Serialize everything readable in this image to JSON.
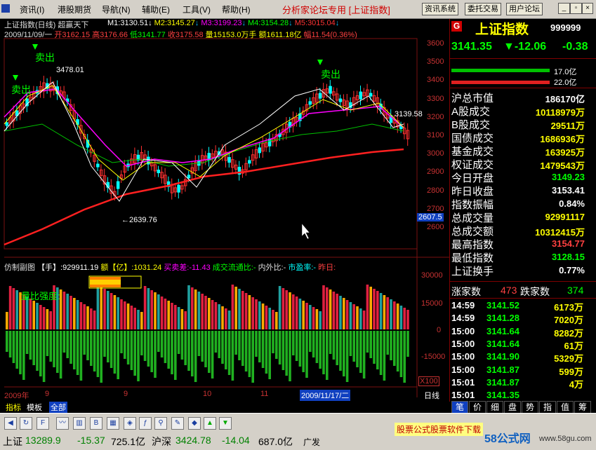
{
  "menu": {
    "items": [
      "资讯(I)",
      "港股期货",
      "导航(N)",
      "辅助(E)",
      "工具(V)",
      "帮助(H)"
    ],
    "title": "分析家论坛专用 [上证指数]",
    "buttons": [
      "资讯系统",
      "委托交易",
      "用户论坛"
    ]
  },
  "chart": {
    "name_line": "上证指数(日线) 超赢天下",
    "ma": [
      {
        "label": "M1:3130.51",
        "color": "#ffffff"
      },
      {
        "label": "M2:3145.27",
        "color": "#ffff00"
      },
      {
        "label": "M3:3199.23",
        "color": "#ff00ff"
      },
      {
        "label": "M4:3154.28",
        "color": "#00ff00"
      },
      {
        "label": "M5:3015.04",
        "color": "#ff3333"
      }
    ],
    "ohlc_line": {
      "date": "2009/11/09/一",
      "open": "开3162.15",
      "high": "高3176.66",
      "low": "低3141.77",
      "close": "收3175.58",
      "volume": "量15153.0万手",
      "amount": "额1611.18亿",
      "range": "幅11.54(0.36%)"
    },
    "annotations": {
      "sell1": "卖出",
      "sell2": "卖出",
      "sell3": "卖出",
      "high": "3478.01",
      "low": "←2639.76",
      "last": "3139.58",
      "cursor_price": "2607.5"
    },
    "price_ticks": [
      "3600",
      "3500",
      "3400",
      "3300",
      "3200",
      "3100",
      "3000",
      "2900",
      "2800",
      "2700",
      "2600"
    ],
    "sub_line": {
      "name": "仿制副图",
      "hand": "【手】:929911.19",
      "amount": "额【亿】:1031.24",
      "buy_sell": "买卖差:-11.43",
      "flow": "成交流通比:-",
      "inout": "内外比:-",
      "pe": "市盈率:-",
      "yesterday": "昨日:"
    },
    "sub_label": "量比强度:",
    "sub_ticks": [
      "30000",
      "15000",
      "0",
      "-15000"
    ],
    "x100": "X100",
    "date_labels": [
      {
        "text": "2009年",
        "color": "#c83232"
      },
      {
        "text": "9",
        "color": "#c83232"
      },
      {
        "text": "9",
        "color": "#c83232"
      },
      {
        "text": "10",
        "color": "#c83232"
      },
      {
        "text": "11",
        "color": "#c83232"
      }
    ],
    "cursor_date": "2009/11/17/二",
    "period": "日线"
  },
  "panel": {
    "badge": "G",
    "name": "上证指数",
    "code": "999999",
    "price": "3141.35",
    "change": "▼-12.06",
    "change_pct": "-0.38",
    "bar1": "17.0亿",
    "bar2": "22.0亿",
    "stats": [
      {
        "label": "沪总市值",
        "value": "186170亿",
        "color": "#ffffff"
      },
      {
        "label": "A股成交",
        "value": "10118979万",
        "color": "#ffff00"
      },
      {
        "label": "B股成交",
        "value": "29511万",
        "color": "#ffff00"
      },
      {
        "label": "国债成交",
        "value": "1686936万",
        "color": "#ffff00"
      },
      {
        "label": "基金成交",
        "value": "163925万",
        "color": "#ffff00"
      },
      {
        "label": "权证成交",
        "value": "1479543万",
        "color": "#ffff00"
      },
      {
        "label": "今日开盘",
        "value": "3149.23",
        "color": "#00ff00"
      },
      {
        "label": "昨日收盘",
        "value": "3153.41",
        "color": "#ffffff"
      },
      {
        "label": "指数振幅",
        "value": "0.84%",
        "color": "#ffffff"
      },
      {
        "label": "总成交量",
        "value": "92991117",
        "color": "#ffff00"
      },
      {
        "label": "总成交额",
        "value": "10312415万",
        "color": "#ffff00"
      },
      {
        "label": "最高指数",
        "value": "3154.77",
        "color": "#ff4040"
      },
      {
        "label": "最低指数",
        "value": "3128.15",
        "color": "#00ff00"
      },
      {
        "label": "上证换手",
        "value": "0.77%",
        "color": "#ffffff"
      }
    ],
    "rise_label": "涨家数",
    "rise": "473",
    "fall_label": "跌家数",
    "fall": "374",
    "ticks": [
      {
        "time": "14:59",
        "price": "3141.52",
        "vol": "6173万"
      },
      {
        "time": "14:59",
        "price": "3141.28",
        "vol": "7020万"
      },
      {
        "time": "15:00",
        "price": "3141.64",
        "vol": "8282万"
      },
      {
        "time": "15:00",
        "price": "3141.64",
        "vol": "61万"
      },
      {
        "time": "15:00",
        "price": "3141.90",
        "vol": "5329万"
      },
      {
        "time": "15:00",
        "price": "3141.87",
        "vol": "599万"
      },
      {
        "time": "15:01",
        "price": "3141.87",
        "vol": "4万"
      },
      {
        "time": "15:01",
        "price": "3141.35",
        "vol": ""
      }
    ],
    "tabs": [
      "笔",
      "价",
      "细",
      "盘",
      "势",
      "指",
      "值",
      "筹"
    ]
  },
  "bottom_tabs": [
    "指标",
    "模板",
    "全部"
  ],
  "status": {
    "sh_label": "上证",
    "sh_value": "13289.9",
    "sh_change": "-15.37",
    "sh_amount": "725.1亿",
    "sz_label": "沪深",
    "sz_value": "3424.78",
    "sz_change": "-14.04",
    "sz_amount": "687.0亿",
    "broker": "广发",
    "ad": "股票公式股票软件下载",
    "site": "58公式网",
    "site_url": "www.58gu.com"
  }
}
